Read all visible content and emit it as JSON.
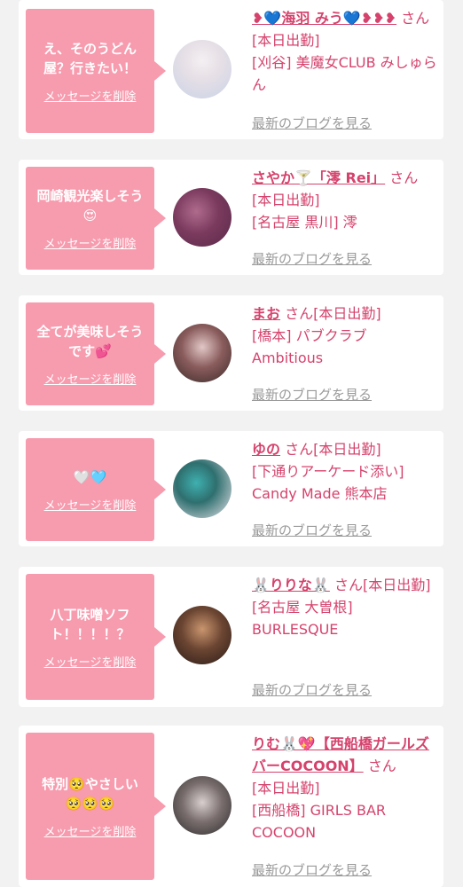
{
  "items": [
    {
      "message": "え、そのうどん屋？行きたい！",
      "delete_label": "メッセージを削除",
      "name": "❥💙海羽 みう💙❥❥❥",
      "suffix": "さん",
      "status": "[本日出勤]",
      "shop": "[刈谷] 美魔女CLUB みしゅらん",
      "blog_label": "最新のブログを見る",
      "avatar_colors": [
        "#f4f0f2",
        "#c9d3e6"
      ]
    },
    {
      "message": "岡崎観光楽しそう😍",
      "delete_label": "メッセージを削除",
      "name": "さやか🍸「澪 Rei」",
      "suffix": "さん",
      "status": "[本日出勤]",
      "shop": "[名古屋 黒川] 澪",
      "blog_label": "最新のブログを見る",
      "avatar_colors": [
        "#5a2a4a",
        "#b06b8c"
      ]
    },
    {
      "message": "全てが美味しそうです💕",
      "delete_label": "メッセージを削除",
      "name": "まお",
      "suffix": "さん",
      "status": "[本日出勤]",
      "shop": "[橋本] パブクラブ Ambitious",
      "blog_label": "最新のブログを見る",
      "avatar_colors": [
        "#3b2a2a",
        "#e2c7c7"
      ]
    },
    {
      "message": "🤍🩵",
      "delete_label": "メッセージを削除",
      "name": "ゆの",
      "suffix": "さん",
      "status": "[本日出勤]",
      "shop": "[下通りアーケード添い] Candy Made 熊本店",
      "blog_label": "最新のブログを見る",
      "avatar_colors": [
        "#2f6f6f",
        "#e8e4ea"
      ]
    },
    {
      "message": "八丁味噌ソフト！！！！？",
      "delete_label": "メッセージを削除",
      "name": "🐰りりな🐰",
      "suffix": "さん",
      "status": "[本日出勤]",
      "shop": "[名古屋 大曽根] BURLESQUE",
      "blog_label": "最新のブログを見る",
      "avatar_colors": [
        "#2a1c18",
        "#c9956e"
      ]
    },
    {
      "message": "特別🥺やさしい🥺🥺🥺",
      "delete_label": "メッセージを削除",
      "name": "りむ🐰💖【西船橋ガールズバーCOCOON】",
      "suffix": "さん",
      "status": "[本日出勤]",
      "shop": "[西船橋] GIRLS BAR COCOON",
      "blog_label": "最新のブログを見る",
      "avatar_colors": [
        "#2c2c2c",
        "#d9cfcf"
      ]
    }
  ]
}
